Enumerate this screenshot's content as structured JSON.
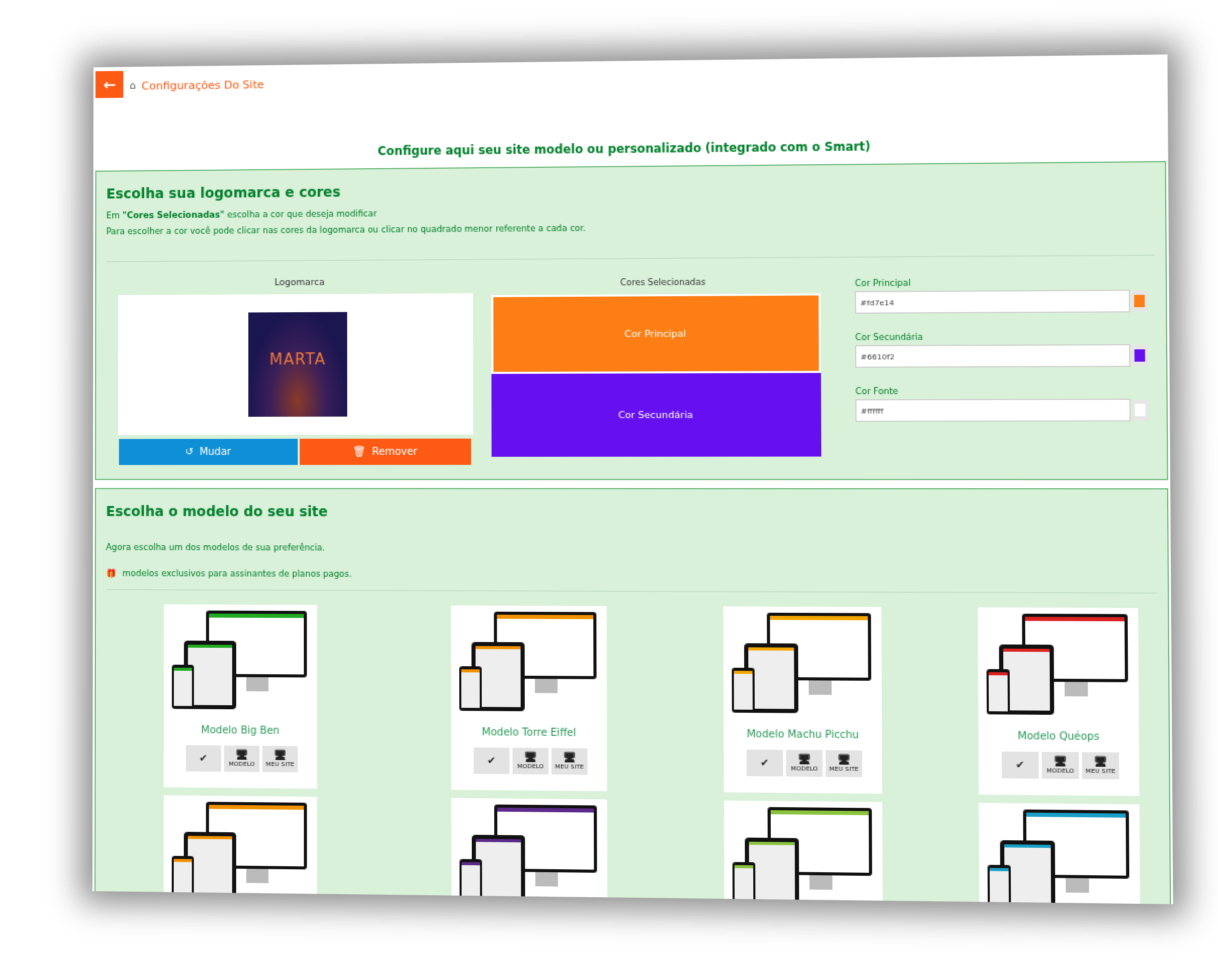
{
  "header": {
    "back_icon": "arrow-left-icon",
    "home_icon": "home-icon",
    "breadcrumb": "Configurações Do Site"
  },
  "title": "Configure aqui seu site modelo ou personalizado (integrado com o Smart)",
  "logo_section": {
    "heading": "Escolha sua logomarca e cores",
    "line1_prefix": "Em ",
    "line1_bold": "\"Cores Selecionadas\"",
    "line1_suffix": " escolha a cor que deseja modificar",
    "line2": "Para escolher a cor você pode clicar nas cores da logomarca ou clicar no quadrado menor referente a cada cor.",
    "logo_label": "Logomarca",
    "logo_text": "MARTA",
    "change_button": "Mudar",
    "remove_button": "Remover",
    "selected_colors_label": "Cores Selecionadas",
    "primary_box": "Cor Principal",
    "secondary_box": "Cor Secundária",
    "fields": [
      {
        "label": "Cor Principal",
        "value": "#fd7e14",
        "color": "#fd7e14"
      },
      {
        "label": "Cor Secundária",
        "value": "#6610f2",
        "color": "#6610f2"
      },
      {
        "label": "Cor Fonte",
        "value": "#ffffff",
        "color": "#ffffff"
      }
    ]
  },
  "model_section": {
    "heading": "Escolha o modelo do seu site",
    "subtitle": "Agora escolha um dos modelos de sua preferência.",
    "exclusive_note": "modelos exclusivos para assinantes de planos pagos.",
    "select_icon": "check-icon",
    "model_label": "MODELO",
    "mysite_label": "MEU SITE",
    "models": [
      {
        "name": "Modelo Big Ben",
        "accent": "#22aa22"
      },
      {
        "name": "Modelo Torre Eiffel",
        "accent": "#f39200"
      },
      {
        "name": "Modelo Machu Picchu",
        "accent": "#f3a500"
      },
      {
        "name": "Modelo Quéops",
        "accent": "#dd2222"
      }
    ],
    "more_models_accents": [
      "#f39200",
      "#5b2a8a",
      "#8ac43f",
      "#1aa0c8"
    ]
  }
}
